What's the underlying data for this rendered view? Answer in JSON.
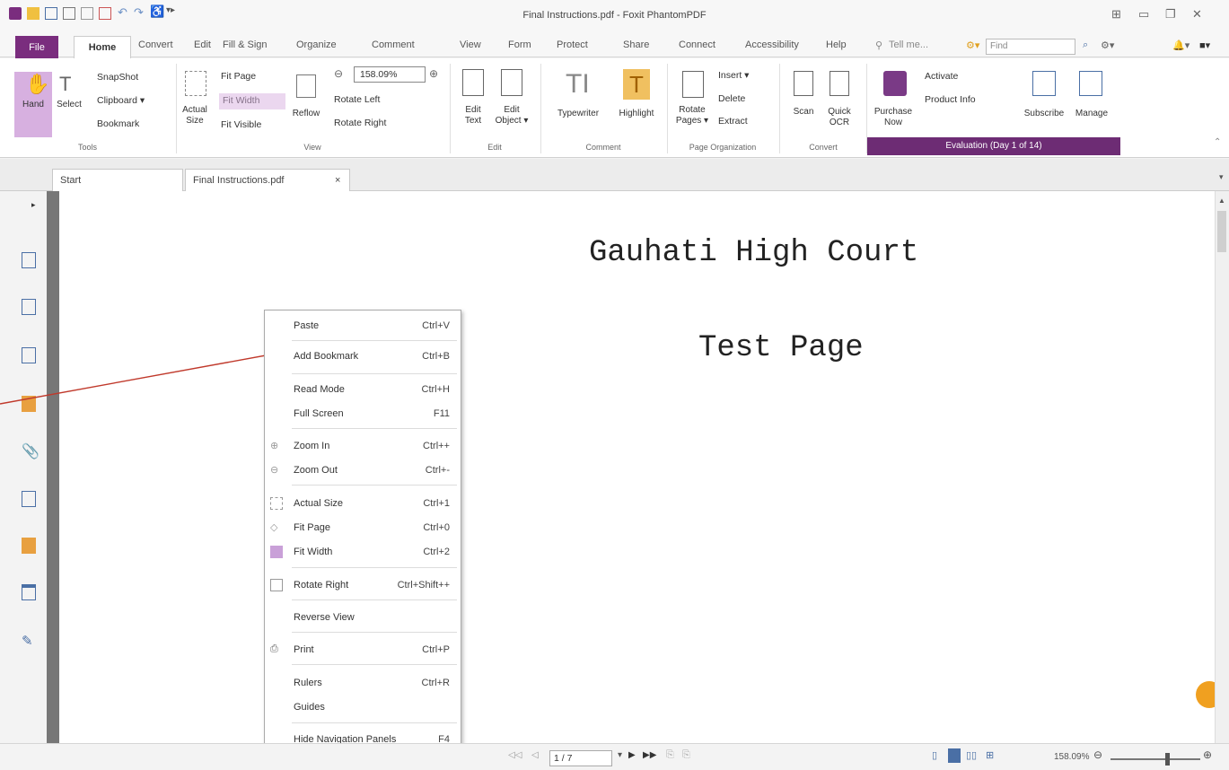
{
  "window": {
    "title": "Final Instructions.pdf - Foxit PhantomPDF"
  },
  "tabs": [
    "File",
    "Home",
    "Convert",
    "Edit",
    "Fill & Sign",
    "Organize",
    "Comment",
    "View",
    "Form",
    "Protect",
    "Share",
    "Connect",
    "Accessibility",
    "Help"
  ],
  "tell_me": "Tell me...",
  "search": {
    "placeholder": "Find"
  },
  "ribbon": {
    "tools": {
      "hand": "Hand",
      "select": "Select",
      "snapshot": "SnapShot",
      "clipboard": "Clipboard ▾",
      "bookmark": "Bookmark",
      "group": "Tools"
    },
    "view": {
      "actual_size": "Actual Size",
      "fit_page": "Fit Page",
      "fit_width": "Fit Width",
      "fit_visible": "Fit Visible",
      "reflow": "Reflow",
      "zoom_value": "158.09%",
      "rotate_left": "Rotate Left",
      "rotate_right": "Rotate Right",
      "group": "View"
    },
    "edit": {
      "edit_text": "Edit Text",
      "edit_object": "Edit Object ▾",
      "group": "Edit"
    },
    "comment": {
      "typewriter": "Typewriter",
      "highlight": "Highlight",
      "group": "Comment"
    },
    "page_org": {
      "rotate_pages": "Rotate Pages ▾",
      "insert": "Insert ▾",
      "delete": "Delete",
      "extract": "Extract",
      "group": "Page Organization"
    },
    "convert": {
      "scan": "Scan",
      "quick_ocr": "Quick OCR",
      "group": "Convert"
    },
    "evaluation": {
      "purchase_now": "Purchase Now",
      "activate": "Activate",
      "product_info": "Product Info",
      "subscribe": "Subscribe",
      "manage": "Manage",
      "group": "Evaluation (Day 1 of 14)"
    }
  },
  "doc_tabs": {
    "start": "Start",
    "file": "Final Instructions.pdf",
    "close": "×"
  },
  "document": {
    "heading": "Gauhati High Court",
    "subheading": "Test Page"
  },
  "context_menu": [
    {
      "label": "Paste",
      "shortcut": "Ctrl+V"
    },
    {
      "label": "Add Bookmark",
      "shortcut": "Ctrl+B"
    },
    {
      "label": "Read Mode",
      "shortcut": "Ctrl+H"
    },
    {
      "label": "Full Screen",
      "shortcut": "F11"
    },
    {
      "label": "Zoom In",
      "shortcut": "Ctrl++"
    },
    {
      "label": "Zoom Out",
      "shortcut": "Ctrl+-"
    },
    {
      "label": "Actual Size",
      "shortcut": "Ctrl+1"
    },
    {
      "label": "Fit Page",
      "shortcut": "Ctrl+0"
    },
    {
      "label": "Fit Width",
      "shortcut": "Ctrl+2"
    },
    {
      "label": "Rotate Right",
      "shortcut": "Ctrl+Shift++"
    },
    {
      "label": "Reverse View",
      "shortcut": ""
    },
    {
      "label": "Print",
      "shortcut": "Ctrl+P"
    },
    {
      "label": "Rulers",
      "shortcut": "Ctrl+R"
    },
    {
      "label": "Guides",
      "shortcut": ""
    },
    {
      "label": "Hide Navigation Panels",
      "shortcut": "F4"
    }
  ],
  "status": {
    "page": "1 / 7",
    "zoom": "158.09%"
  },
  "colors": {
    "accent": "#7a2d7e",
    "highlight": "#d7b0e0",
    "arrow": "#c0392b"
  }
}
